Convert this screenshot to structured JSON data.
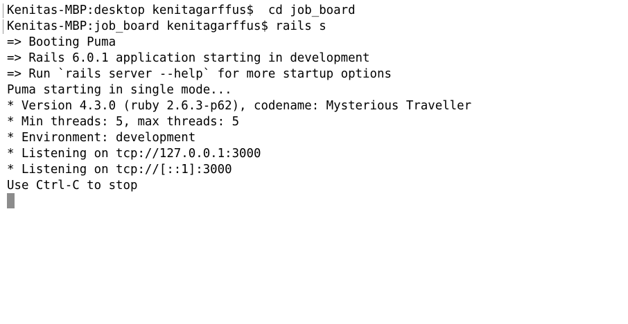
{
  "terminal": {
    "lines": [
      "Kenitas-MBP:desktop kenitagarffus$  cd job_board",
      "Kenitas-MBP:job_board kenitagarffus$ rails s",
      "=> Booting Puma",
      "=> Rails 6.0.1 application starting in development",
      "=> Run `rails server --help` for more startup options",
      "Puma starting in single mode...",
      "* Version 4.3.0 (ruby 2.6.3-p62), codename: Mysterious Traveller",
      "* Min threads: 5, max threads: 5",
      "* Environment: development",
      "* Listening on tcp://127.0.0.1:3000",
      "* Listening on tcp://[::1]:3000",
      "Use Ctrl-C to stop"
    ]
  }
}
